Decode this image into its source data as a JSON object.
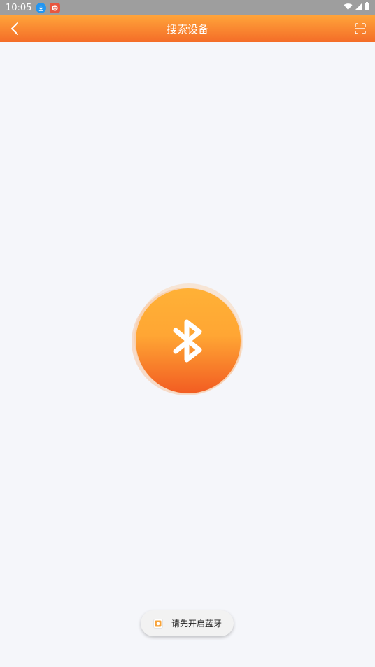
{
  "status_bar": {
    "time": "10:05",
    "icons": [
      "download-app-icon",
      "smile-app-icon",
      "wifi-icon",
      "signal-icon",
      "battery-icon"
    ]
  },
  "app_bar": {
    "title": "搜索设备",
    "back_icon": "chevron-left-icon",
    "action_icon": "scan-icon"
  },
  "main": {
    "bluetooth_icon": "bluetooth-icon"
  },
  "toast": {
    "message": "请先开启蓝牙"
  },
  "colors": {
    "accent": "#ff9a30",
    "accent_dark": "#f25c22",
    "background": "#f5f6fa"
  }
}
